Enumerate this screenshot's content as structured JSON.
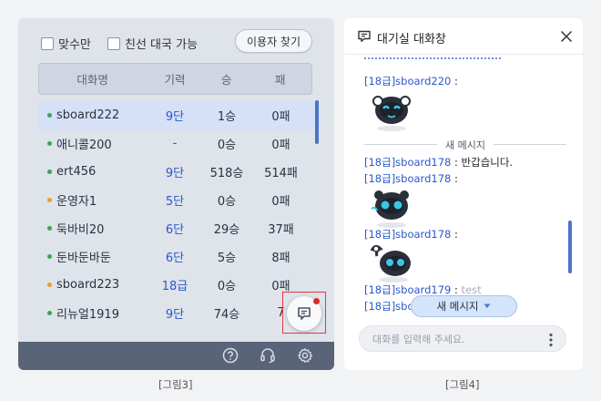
{
  "left_panel": {
    "filters": [
      {
        "label": "맞수만",
        "checked": false
      },
      {
        "label": "친선 대국 가능",
        "checked": false
      }
    ],
    "find_user_button": "이용자 찾기",
    "table": {
      "headers": [
        "대화명",
        "기력",
        "승",
        "패"
      ],
      "rows": [
        {
          "name": "sboard222",
          "rank": "9단",
          "wins": "1승",
          "losses": "0패",
          "status_color": "#3aa655",
          "selected": true
        },
        {
          "name": "애니콜200",
          "rank": "-",
          "wins": "0승",
          "losses": "0패",
          "status_color": "#3aa655",
          "selected": false
        },
        {
          "name": "ert456",
          "rank": "9단",
          "wins": "518승",
          "losses": "514패",
          "status_color": "#3aa655",
          "selected": false
        },
        {
          "name": "운영자1",
          "rank": "5단",
          "wins": "0승",
          "losses": "0패",
          "status_color": "#e0a12a",
          "selected": false
        },
        {
          "name": "둑바비20",
          "rank": "6단",
          "wins": "29승",
          "losses": "37패",
          "status_color": "#3aa655",
          "selected": false
        },
        {
          "name": "둔바둔바둔",
          "rank": "6단",
          "wins": "5승",
          "losses": "8패",
          "status_color": "#3aa655",
          "selected": false
        },
        {
          "name": "sboard223",
          "rank": "18급",
          "wins": "0승",
          "losses": "0패",
          "status_color": "#e0a12a",
          "selected": false
        },
        {
          "name": "리뉴얼1919",
          "rank": "9단",
          "wins": "74승",
          "losses": "7",
          "status_color": "#3aa655",
          "selected": false
        }
      ]
    },
    "chat_button_icon": "chat-icon",
    "bottom_icons": [
      "help-icon",
      "headset-icon",
      "gear-icon"
    ],
    "caption": "[그림3]"
  },
  "right_panel": {
    "title": "대기실 대화창",
    "messages_top": [
      {
        "sender": "[18급]sboard220",
        "text": "",
        "sticker": true
      }
    ],
    "new_message_divider": "새 메시지",
    "messages_bottom": [
      {
        "sender": "[18급]sboard178",
        "text": "반갑습니다."
      },
      {
        "sender": "[18급]sboard178",
        "text": "",
        "sticker": true
      },
      {
        "sender": "[18급]sboard178",
        "text": "",
        "sticker": true
      },
      {
        "sender": "[18급]sboard179",
        "text": "test"
      },
      {
        "sender": "[18급]sboard178",
        "text": ""
      }
    ],
    "new_message_button": "새 메시지",
    "input_placeholder": "대화를 입력해 주세요.",
    "caption": "[그림4]"
  },
  "colors": {
    "accent": "#2a59c9",
    "bottom_bar": "#5a6478",
    "highlight_frame": "#e23b3b",
    "notification": "#d92a2a"
  }
}
